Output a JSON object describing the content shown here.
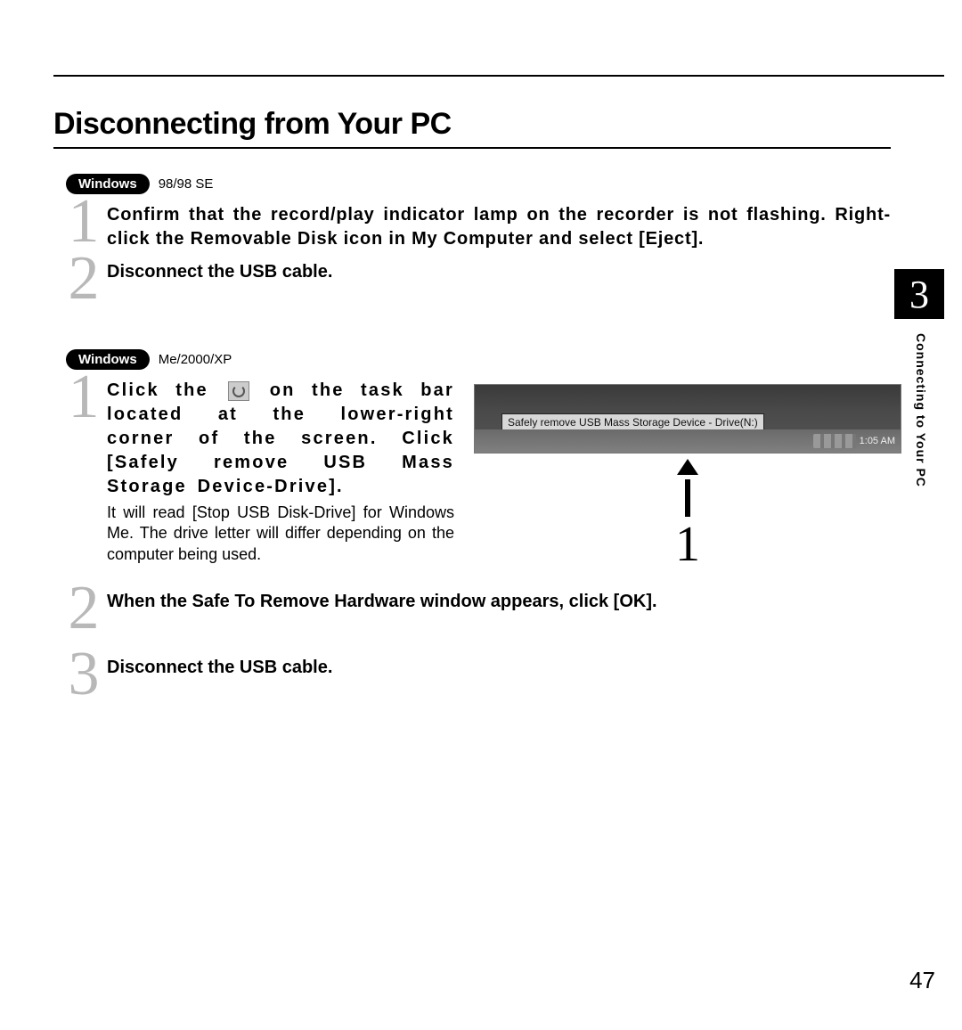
{
  "title": "Disconnecting from Your PC",
  "chapter_tab": "3",
  "chapter_label": "Connecting to Your PC",
  "page_number": "47",
  "os1": {
    "badge": "Windows",
    "ver": "98/98 SE"
  },
  "os1_steps": {
    "s1_num": "1",
    "s1_text": "Confirm that the record/play indicator lamp on the recorder is not flashing. Right-click the Removable Disk icon in My Computer and select [Eject].",
    "s2_num": "2",
    "s2_text": "Disconnect the USB cable."
  },
  "os2": {
    "badge": "Windows",
    "ver": "Me/2000/XP"
  },
  "os2_steps": {
    "s1_num": "1",
    "s1_pre": "Click the",
    "s1_post": "on the task bar located at the lower-right corner of the screen. Click [Safely remove USB Mass Storage Device-Drive].",
    "s1_note": "It will read [Stop USB Disk-Drive] for Windows Me. The drive letter will differ depending on the computer being used.",
    "s2_num": "2",
    "s2_text": "When the Safe To Remove Hardware window appears, click [OK].",
    "s3_num": "3",
    "s3_text": "Disconnect the USB cable."
  },
  "screenshot": {
    "tooltip": "Safely remove USB Mass Storage Device - Drive(N:)",
    "clock": "1:05 AM",
    "callout": "1"
  }
}
